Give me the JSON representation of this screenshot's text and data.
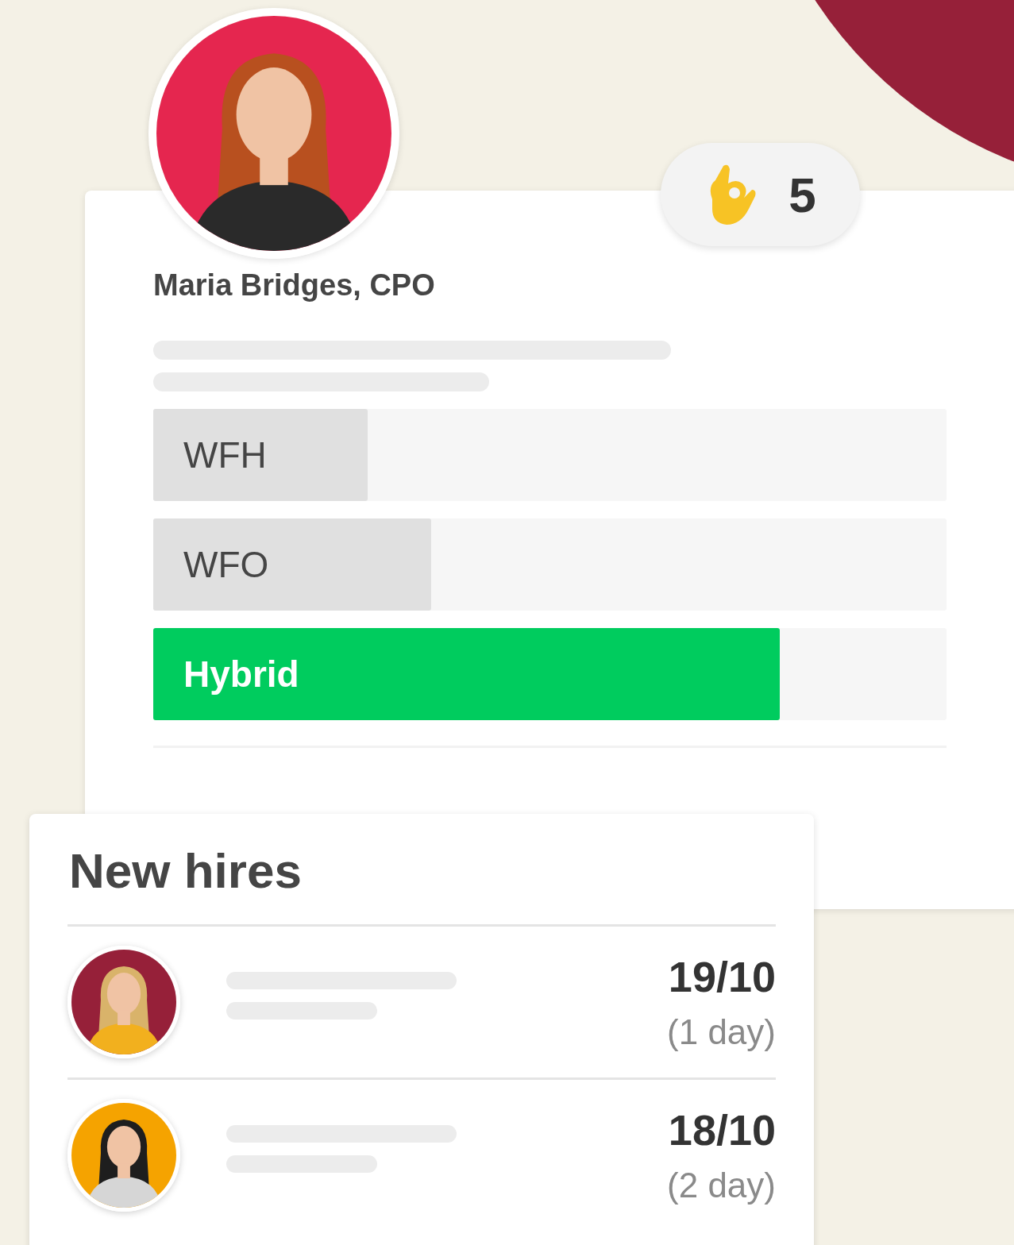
{
  "profile": {
    "name": "Maria Bridges, CPO"
  },
  "reaction": {
    "count": "5"
  },
  "poll": [
    {
      "label": "WFH",
      "level": 0.27,
      "selected": false
    },
    {
      "label": "WFO",
      "level": 0.35,
      "selected": false
    },
    {
      "label": "Hybrid",
      "level": 0.79,
      "selected": true
    }
  ],
  "new_hires": {
    "title": "New hires",
    "hires": [
      {
        "date": "19/10",
        "duration": "(1 day)"
      },
      {
        "date": "18/10",
        "duration": "(2 day)"
      }
    ]
  }
}
